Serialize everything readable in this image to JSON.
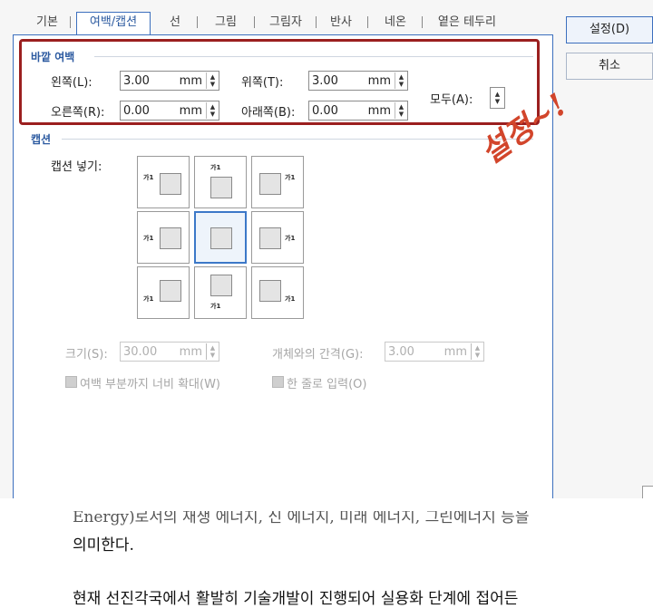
{
  "tabs": [
    "기본",
    "여백/캡션",
    "선",
    "그림",
    "그림자",
    "반사",
    "네온",
    "옅은 테두리"
  ],
  "buttons": {
    "ok": "설정(D)",
    "cancel": "취소"
  },
  "outer_margin": {
    "title": "바깥 여백",
    "left": {
      "label": "왼쪽(L):",
      "value": "3.00",
      "unit": "mm"
    },
    "top": {
      "label": "위쪽(T):",
      "value": "3.00",
      "unit": "mm"
    },
    "right": {
      "label": "오른쪽(R):",
      "value": "0.00",
      "unit": "mm"
    },
    "bottom": {
      "label": "아래쪽(B):",
      "value": "0.00",
      "unit": "mm"
    },
    "all_label": "모두(A):"
  },
  "caption": {
    "title": "캡션",
    "insert_label": "캡션 넣기:",
    "cell_text": "가1",
    "size": {
      "label": "크기(S):",
      "value": "30.00",
      "unit": "mm"
    },
    "gap": {
      "label": "개체와의 간격(G):",
      "value": "3.00",
      "unit": "mm"
    },
    "expand_label": "여백 부분까지 너비 확대(W)",
    "oneline_label": "한 줄로 입력(O)"
  },
  "annotation": "설정~!",
  "document": {
    "line1": "Energy)로서의 재생 에너지, 신 에너지, 미래 에너지, 그린에너지 등을",
    "line2": "의미한다.",
    "line3": "현재 선진각국에서 활발히 기술개발이 진행되어 실용화 단계에 접어든"
  },
  "colors": {
    "accent": "#3c6fbe",
    "highlight": "#9b1f1f",
    "handwriting": "#d2452b"
  }
}
